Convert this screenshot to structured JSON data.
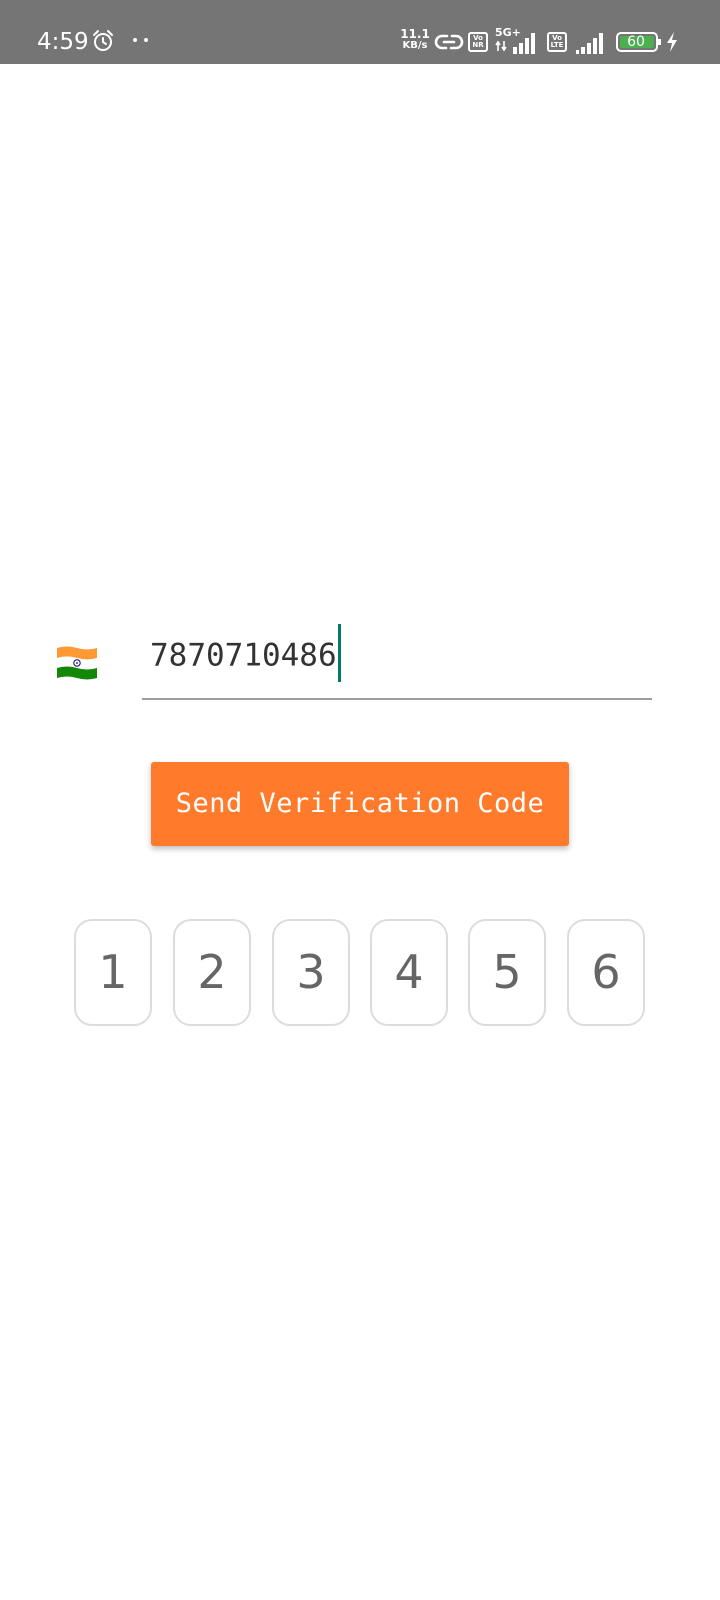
{
  "status_bar": {
    "time": "4:59",
    "net_speed_value": "11.1",
    "net_speed_unit": "KB/s",
    "sim1_badge_top": "Vo",
    "sim1_badge_bottom": "NR",
    "sim1_network": "5G+",
    "sim2_badge_top": "Vo",
    "sim2_badge_bottom": "LTE",
    "battery_level": "60",
    "icons": [
      "alarm-icon",
      "more-dots-icon",
      "link-icon",
      "signal-icon",
      "battery-icon",
      "charging-bolt-icon"
    ]
  },
  "phone_form": {
    "country_flag": "india-flag-icon",
    "phone_number": "7870710486",
    "send_button_label": "Send Verification Code"
  },
  "code_digits": [
    "1",
    "2",
    "3",
    "4",
    "5",
    "6"
  ],
  "colors": {
    "status_bar_bg": "#757575",
    "button_bg": "#ff7a2a",
    "caret": "#00796b",
    "battery_fill": "#4caf50",
    "flag_saffron": "#ff9933",
    "flag_green": "#138808",
    "chakra_blue": "#000080"
  }
}
